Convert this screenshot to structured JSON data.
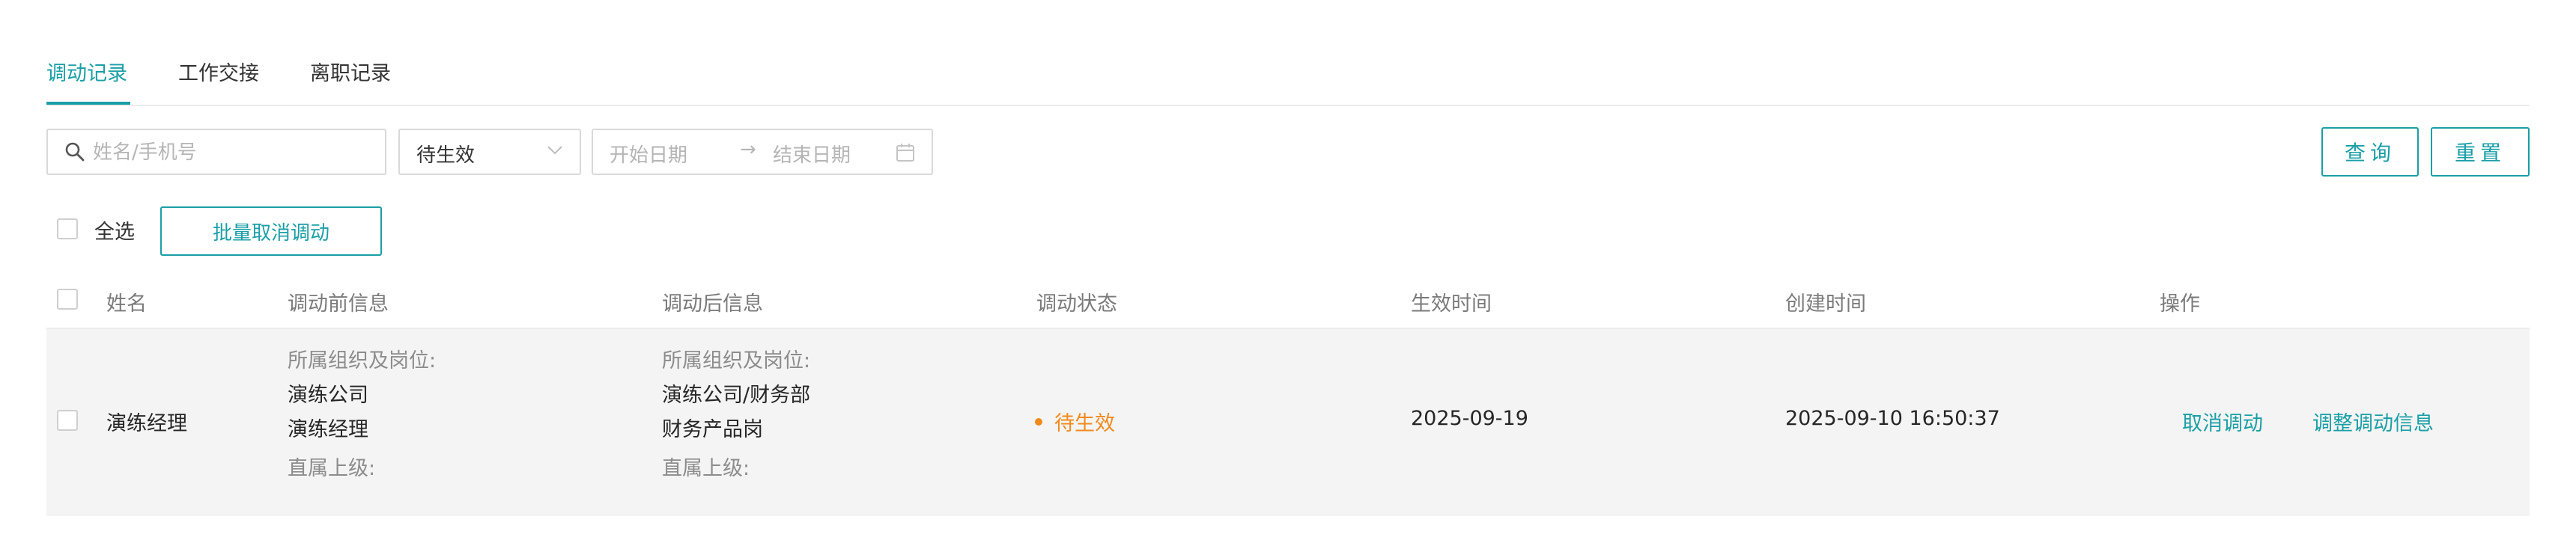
{
  "tabs": [
    {
      "label": "调动记录",
      "active": true
    },
    {
      "label": "工作交接",
      "active": false
    },
    {
      "label": "离职记录",
      "active": false
    }
  ],
  "filters": {
    "search_placeholder": "姓名/手机号",
    "status_value": "待生效",
    "start_date_placeholder": "开始日期",
    "range_arrow": "→",
    "end_date_placeholder": "结束日期"
  },
  "buttons": {
    "query": "查询",
    "reset": "重置",
    "batch_cancel": "批量取消调动"
  },
  "select_all_label": "全选",
  "table": {
    "headers": {
      "name": "姓名",
      "before": "调动前信息",
      "after": "调动后信息",
      "status": "调动状态",
      "effective": "生效时间",
      "created": "创建时间",
      "actions": "操作"
    },
    "rows": [
      {
        "name": "演练经理",
        "before": {
          "org_label": "所属组织及岗位:",
          "org": "演练公司",
          "position": "演练经理",
          "superior_label": "直属上级:"
        },
        "after": {
          "org_label": "所属组织及岗位:",
          "org": "演练公司/财务部",
          "position": "财务产品岗",
          "superior_label": "直属上级:"
        },
        "status": "待生效",
        "effective_time": "2025-09-19",
        "created_time": "2025-09-10 16:50:37",
        "actions": {
          "cancel": "取消调动",
          "adjust": "调整调动信息"
        }
      }
    ]
  },
  "colors": {
    "accent": "#1a9fa6",
    "status_pending": "#f08a1c",
    "row_bg": "#f4f4f4"
  }
}
